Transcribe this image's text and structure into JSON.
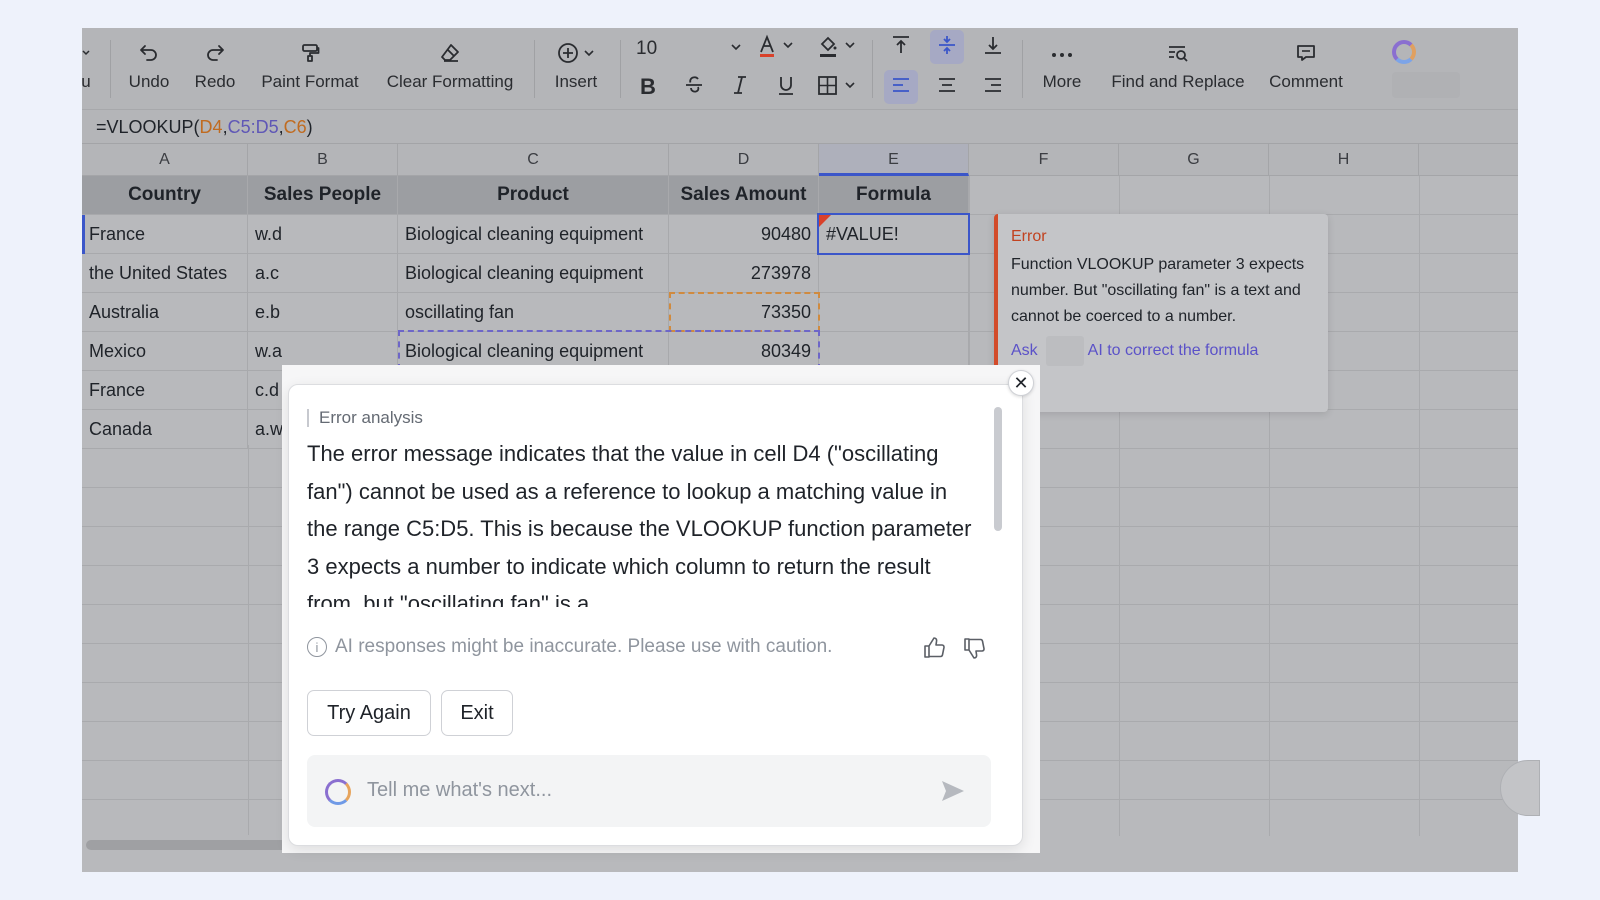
{
  "toolbar": {
    "partial_left": "u",
    "undo": "Undo",
    "redo": "Redo",
    "paint_format": "Paint Format",
    "clear_formatting": "Clear Formatting",
    "insert": "Insert",
    "font_size": "10",
    "more": "More",
    "find_replace": "Find and Replace",
    "comment": "Comment"
  },
  "formula_bar": {
    "prefix": "=VLOOKUP(",
    "arg1": "D4",
    "comma1": ",",
    "arg2": "C5:D5",
    "comma2": ",",
    "arg3": "C6",
    "suffix": ")"
  },
  "columns": [
    "A",
    "B",
    "C",
    "D",
    "E",
    "F",
    "G",
    "H"
  ],
  "table": {
    "headers": [
      "Country",
      "Sales People",
      "Product",
      "Sales Amount",
      "Formula"
    ],
    "rows": [
      [
        "France",
        "w.d",
        "Biological cleaning equipment",
        "90480",
        "#VALUE!"
      ],
      [
        "the United States",
        "a.c",
        "Biological cleaning equipment",
        "273978",
        ""
      ],
      [
        "Australia",
        "e.b",
        "oscillating fan",
        "73350",
        ""
      ],
      [
        "Mexico",
        "w.a",
        "Biological cleaning equipment",
        "80349",
        ""
      ],
      [
        "France",
        "c.d",
        "",
        "",
        ""
      ],
      [
        "Canada",
        "a.w",
        "",
        "",
        ""
      ]
    ]
  },
  "error_tooltip": {
    "title": "Error",
    "message": "Function VLOOKUP parameter 3 expects number. But \"oscillating fan\" is a text and cannot be coerced to a number.",
    "ask": "Ask",
    "ask_rest": "AI to correct the formula"
  },
  "dialog": {
    "section": "Error analysis",
    "body": "The error message indicates that the value in cell D4 (\"oscillating fan\") cannot be used as a reference to lookup a matching value in the range C5:D5. This is because the VLOOKUP function parameter 3 expects a number to indicate which column to return the result from, but \"oscillating fan\" is a",
    "disclaimer": "AI responses might be inaccurate. Please use with caution.",
    "try_again": "Try Again",
    "exit": "Exit",
    "input_placeholder": "Tell me what's next...",
    "close_glyph": "✕",
    "info_glyph": "i"
  },
  "colors": {
    "accent": "#3b56c9",
    "error": "#d24b2a",
    "ai_link": "#5b52c8"
  }
}
